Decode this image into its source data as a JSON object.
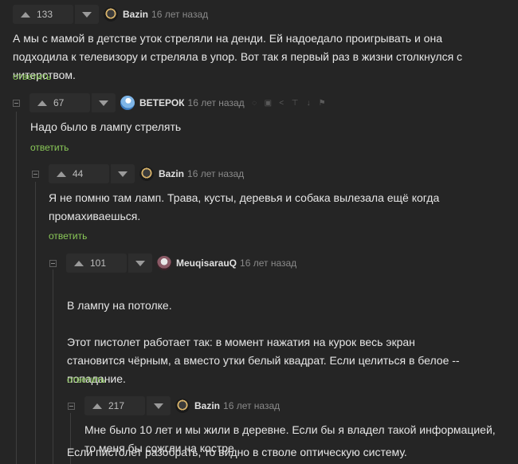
{
  "comments": [
    {
      "rating": "133",
      "author": "Bazin",
      "time": "16 лет назад",
      "text": "А мы с мамой в детстве уток стреляли на денди. Ей надоедало проигрывать и она подходила к телевизору и стреляла в упор. Вот так я первый раз в жизни столкнулся с читерством.",
      "reply": "ответить"
    },
    {
      "rating": "67",
      "author": "ВЕТЕРОК",
      "time": "16 лет назад",
      "text": "Надо было в лампу стрелять",
      "reply": "ответить"
    },
    {
      "rating": "44",
      "author": "Bazin",
      "time": "16 лет назад",
      "text": "Я не помню там ламп. Трава, кусты, деревья и собака вылезала ещё когда промахиваешься.",
      "reply": "ответить"
    },
    {
      "rating": "101",
      "author": "MeuqisarauQ",
      "time": "16 лет назад",
      "text_lines": [
        "В лампу на потолке.",
        "Этот пистолет работает так: в момент нажатия на курок весь экран становится чёрным, а вместо утки белый квадрат. Если целиться в белое -- попадание.",
        "",
        "Если пистолет разобрать, то видно в стволе оптическую систему."
      ],
      "reply": "ответить"
    },
    {
      "rating": "217",
      "author": "Bazin",
      "time": "16 лет назад",
      "text": "Мне было 10 лет и мы жили в деревне. Если бы я владел такой информацией, то меня бы сожгли на костре."
    }
  ],
  "icons": {
    "tool_icons": [
      "report-icon",
      "save-icon",
      "share-icon",
      "branch-icon",
      "link-icon",
      "flag-icon"
    ]
  },
  "colors": {
    "background": "#252525",
    "reply_link": "#8ac858",
    "thread_line": "#3e3e3e"
  }
}
